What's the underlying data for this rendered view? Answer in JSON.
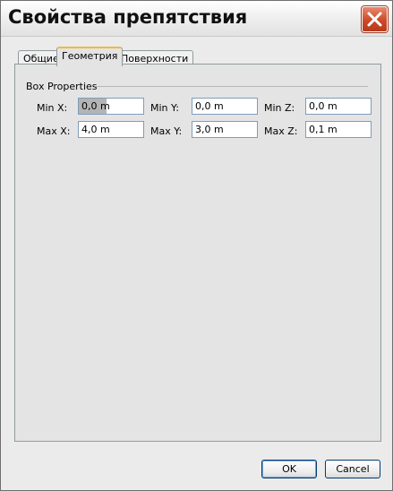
{
  "window": {
    "title": "Свойства препятствия"
  },
  "tabs": [
    {
      "label": "Общие"
    },
    {
      "label": "Геометрия"
    },
    {
      "label": "Поверхности"
    }
  ],
  "box_properties": {
    "group_title": "Box Properties",
    "min_x": {
      "label": "Min X:",
      "value": "0,0 m"
    },
    "min_y": {
      "label": "Min Y:",
      "value": "0,0 m"
    },
    "min_z": {
      "label": "Min Z:",
      "value": "0,0 m"
    },
    "max_x": {
      "label": "Max X:",
      "value": "4,0 m"
    },
    "max_y": {
      "label": "Max Y:",
      "value": "3,0 m"
    },
    "max_z": {
      "label": "Max Z:",
      "value": "0,1 m"
    }
  },
  "buttons": {
    "ok": "OK",
    "cancel": "Cancel"
  },
  "colors": {
    "close_button": "#cc4a2a",
    "active_tab_accent": "#f1b93c",
    "field_border": "#7f9db9"
  },
  "icons": {
    "close": "close-icon"
  }
}
